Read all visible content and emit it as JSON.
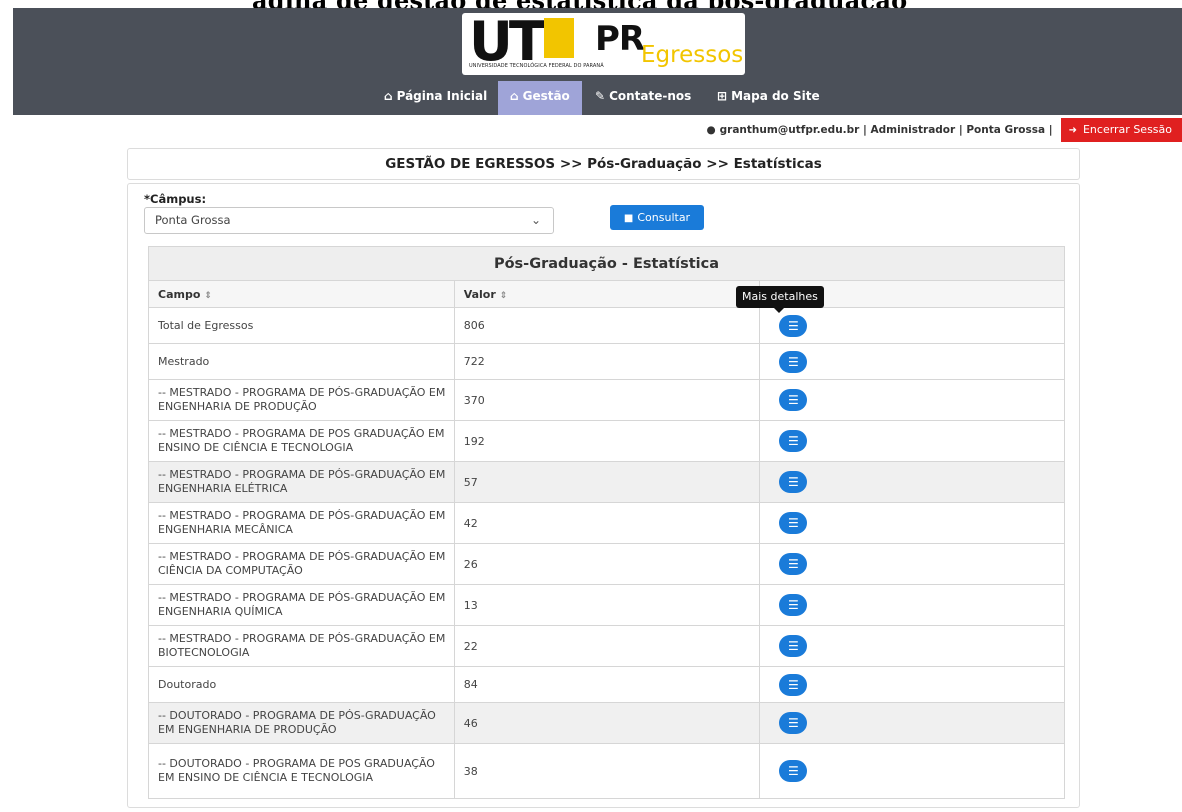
{
  "page_caption": "ágina de gestão de estatística da pós-graduação",
  "logo": {
    "main": "UT",
    "pr": "PR",
    "egressos": "Egressos",
    "subtitle": "UNIVERSIDADE TECNOLÓGICA FEDERAL DO PARANÁ"
  },
  "nav": [
    {
      "label": "Página Inicial",
      "icon": "home-icon",
      "glyph": "⌂"
    },
    {
      "label": "Gestão",
      "icon": "institution-icon",
      "glyph": "🏛"
    },
    {
      "label": "Contate-nos",
      "icon": "edit-icon",
      "glyph": "✎"
    },
    {
      "label": "Mapa do Site",
      "icon": "sitemap-icon",
      "glyph": "⊞"
    }
  ],
  "user": {
    "info": "granthum@utfpr.edu.br | Administrador | Ponta Grossa |",
    "logout_label": "Encerrar Sessão"
  },
  "breadcrumb": "GESTÃO DE EGRESSOS >> Pós-Graduação >> Estatísticas",
  "form": {
    "campus_label": "*Câmpus:",
    "campus_value": "Ponta Grossa",
    "consultar_label": "Consultar"
  },
  "table": {
    "caption": "Pós-Graduação - Estatística",
    "headers": {
      "campo": "Campo",
      "valor": "Valor"
    },
    "tooltip": "Mais detalhes",
    "rows": [
      {
        "campo": "Total de Egressos",
        "valor": "806"
      },
      {
        "campo": "Mestrado",
        "valor": "722"
      },
      {
        "campo": "-- MESTRADO - PROGRAMA DE PÓS-GRADUAÇÃO EM ENGENHARIA DE PRODUÇÃO",
        "valor": "370"
      },
      {
        "campo": "-- MESTRADO - PROGRAMA DE POS GRADUAÇÃO EM ENSINO DE CIÊNCIA E TECNOLOGIA",
        "valor": "192"
      },
      {
        "campo": "-- MESTRADO - PROGRAMA DE PÓS-GRADUAÇÃO EM ENGENHARIA ELÉTRICA",
        "valor": "57"
      },
      {
        "campo": "-- MESTRADO - PROGRAMA DE PÓS-GRADUAÇÃO EM ENGENHARIA MECÂNICA",
        "valor": "42"
      },
      {
        "campo": "-- MESTRADO - PROGRAMA DE PÓS-GRADUAÇÃO EM CIÊNCIA DA COMPUTAÇÃO",
        "valor": "26"
      },
      {
        "campo": "-- MESTRADO - PROGRAMA DE PÓS-GRADUAÇÃO EM ENGENHARIA QUÍMICA",
        "valor": "13"
      },
      {
        "campo": "-- MESTRADO - PROGRAMA DE PÓS-GRADUAÇÃO EM BIOTECNOLOGIA",
        "valor": "22"
      },
      {
        "campo": "Doutorado",
        "valor": "84"
      },
      {
        "campo": "-- DOUTORADO - PROGRAMA DE PÓS-GRADUAÇÃO EM ENGENHARIA DE PRODUÇÃO",
        "valor": "46"
      },
      {
        "campo": "-- DOUTORADO - PROGRAMA DE POS GRADUAÇÃO EM ENSINO DE CIÊNCIA E TECNOLOGIA",
        "valor": "38"
      }
    ]
  },
  "colors": {
    "header_bg": "#4b5059",
    "nav_active": "#9fa4d8",
    "primary_button": "#1a7bd9",
    "logout": "#e02020",
    "logo_yellow": "#f2c500"
  }
}
